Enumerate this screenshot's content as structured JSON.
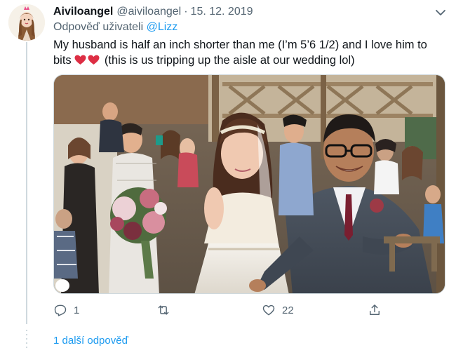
{
  "tweet": {
    "display_name": "Aiviloangel",
    "handle": "@aiviloangel",
    "separator": "·",
    "date": "15. 12. 2019",
    "replying_prefix": "Odpověď uživateli",
    "replying_to": "@Lizz",
    "text_part1": "My husband is half an inch shorter than me (I’m 5’6 1/2) and I love him to bits",
    "text_part2": "(this is us tripping up the aisle at our wedding lol)",
    "heart_color": "#dd2e44"
  },
  "actions": {
    "reply_count": "1",
    "retweet_count": "",
    "like_count": "22"
  },
  "thread": {
    "more_replies": "1 další odpověď"
  },
  "colors": {
    "link": "#1d9bf0",
    "secondary": "#536471"
  }
}
